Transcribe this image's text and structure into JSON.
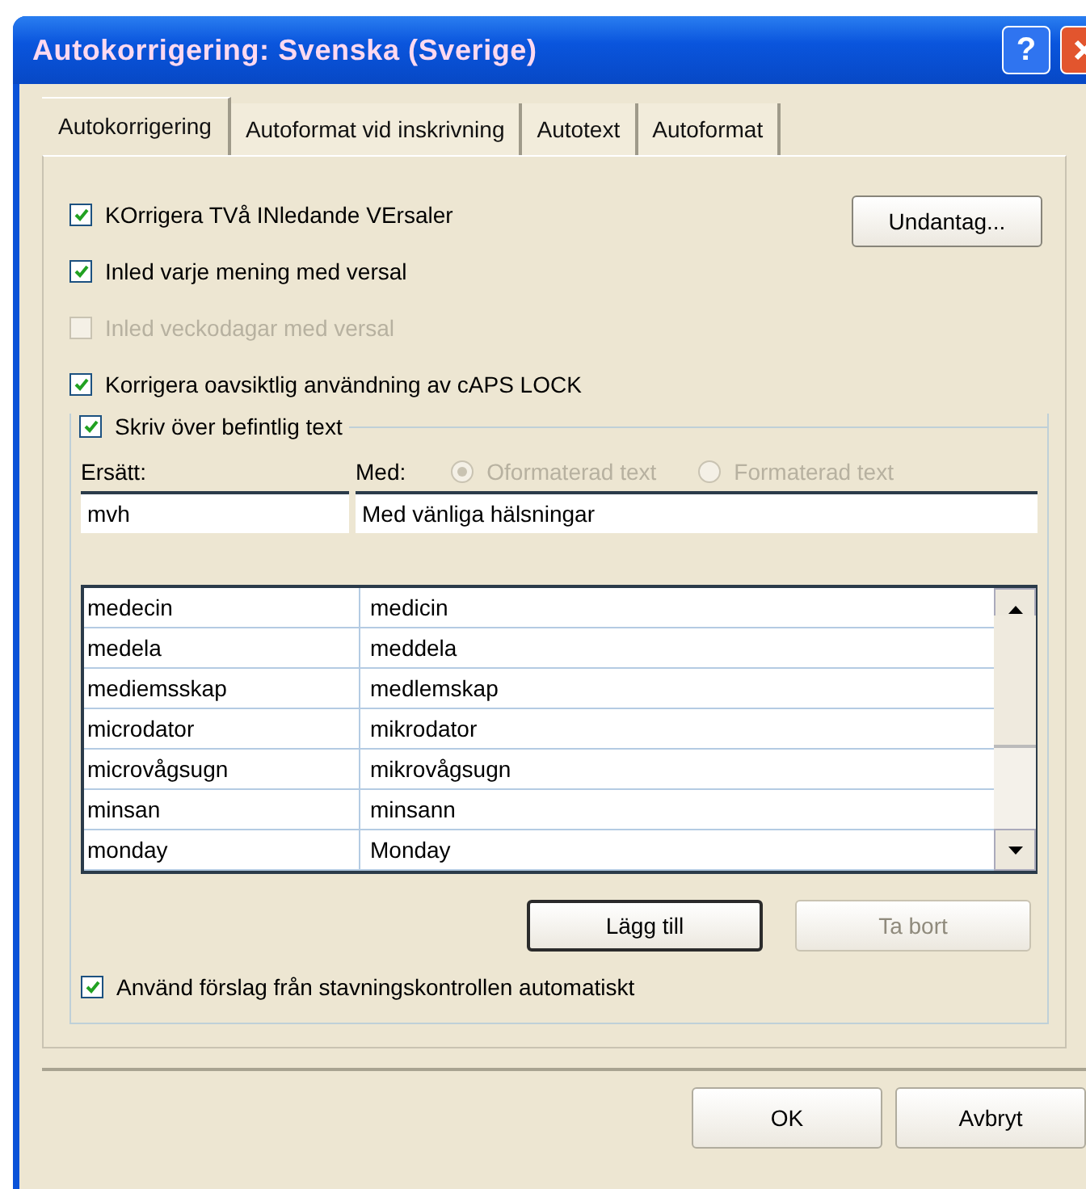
{
  "window": {
    "title": "Autokorrigering: Svenska (Sverige)",
    "help_button": "?"
  },
  "tabs": [
    {
      "label": "Autokorrigering",
      "selected": true
    },
    {
      "label": "Autoformat vid inskrivning",
      "selected": false
    },
    {
      "label": "Autotext",
      "selected": false
    },
    {
      "label": "Autoformat",
      "selected": false
    }
  ],
  "options": [
    {
      "label": "KOrrigera TVå INledande VErsaler",
      "checked": true,
      "disabled": false
    },
    {
      "label": "Inled varje mening med versal",
      "checked": true,
      "disabled": false
    },
    {
      "label": "Inled veckodagar med versal",
      "checked": false,
      "disabled": true
    },
    {
      "label": "Korrigera oavsiktlig användning av cAPS LOCK",
      "checked": true,
      "disabled": false
    }
  ],
  "exceptions_button": "Undantag...",
  "replace_group": {
    "checkbox": {
      "label": "Skriv över befintlig text",
      "checked": true
    },
    "replace_label": "Ersätt:",
    "with_label": "Med:",
    "format_options": [
      {
        "label": "Oformaterad text",
        "selected": true,
        "disabled": true
      },
      {
        "label": "Formaterad text",
        "selected": false,
        "disabled": true
      }
    ],
    "replace_value": "mvh",
    "with_value": "Med vänliga hälsningar",
    "rows": [
      [
        "medecin",
        "medicin"
      ],
      [
        "medela",
        "meddela"
      ],
      [
        "mediemsskap",
        "medlemskap"
      ],
      [
        "microdator",
        "mikrodator"
      ],
      [
        "microvågsugn",
        "mikrovågsugn"
      ],
      [
        "minsan",
        "minsann"
      ],
      [
        "monday",
        "Monday"
      ]
    ],
    "buttons": [
      {
        "label": "Lägg till",
        "disabled": false,
        "default": true
      },
      {
        "label": "Ta bort",
        "disabled": true,
        "default": false
      }
    ],
    "suggest_checkbox": {
      "label": "Använd förslag från stavningskontrollen automatiskt",
      "checked": true
    }
  },
  "footer_buttons": [
    "OK",
    "Avbryt"
  ]
}
